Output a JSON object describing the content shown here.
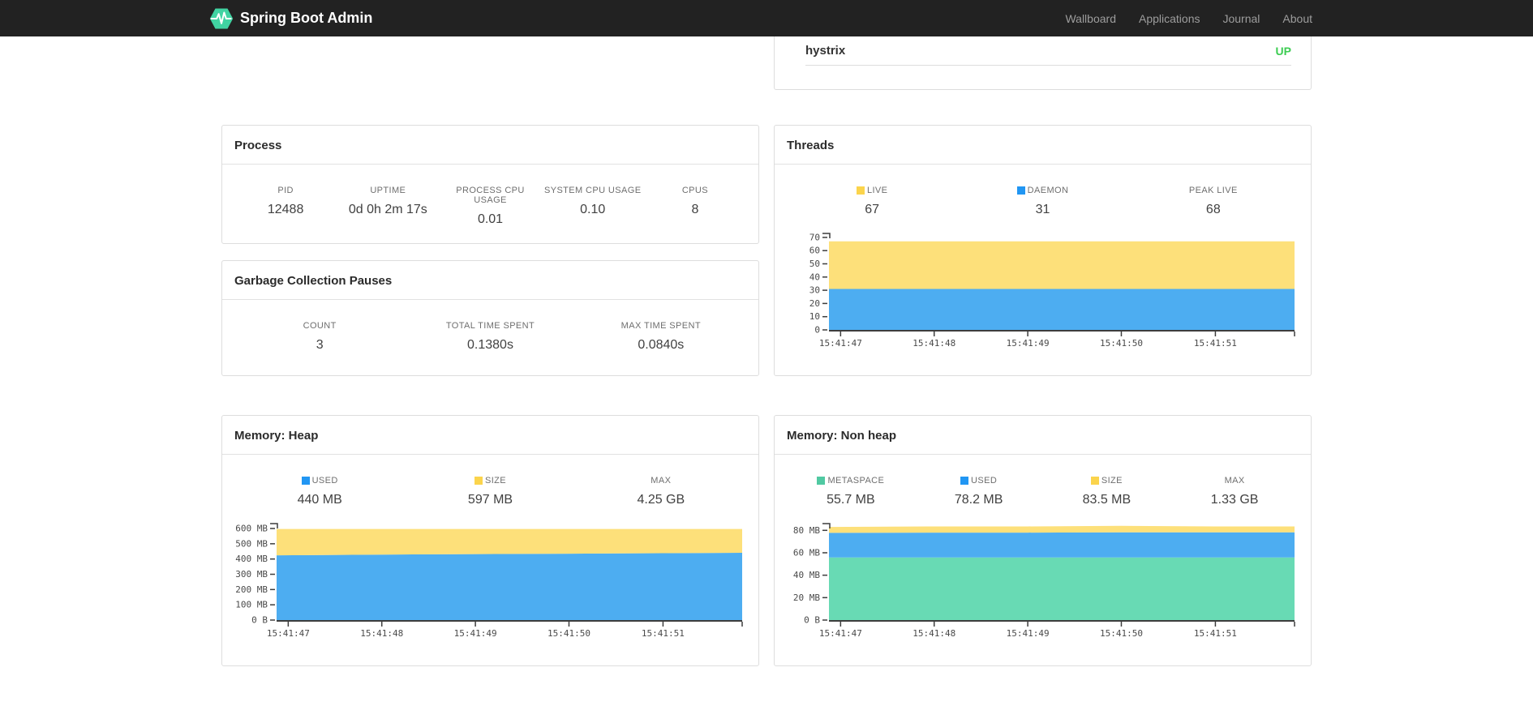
{
  "navbar": {
    "brand": "Spring Boot Admin",
    "items": [
      {
        "label": "Wallboard"
      },
      {
        "label": "Applications"
      },
      {
        "label": "Journal"
      },
      {
        "label": "About"
      }
    ]
  },
  "application_card": {
    "name": "hystrix",
    "status": "UP",
    "status_color": "#3ccc52"
  },
  "process": {
    "title": "Process",
    "metrics": [
      {
        "label": "PID",
        "value": "12488"
      },
      {
        "label": "UPTIME",
        "value": "0d 0h 2m 17s"
      },
      {
        "label": "PROCESS CPU USAGE",
        "value": "0.01"
      },
      {
        "label": "SYSTEM CPU USAGE",
        "value": "0.10"
      },
      {
        "label": "CPUS",
        "value": "8"
      }
    ]
  },
  "gc": {
    "title": "Garbage Collection Pauses",
    "metrics": [
      {
        "label": "COUNT",
        "value": "3"
      },
      {
        "label": "TOTAL TIME SPENT",
        "value": "0.1380s"
      },
      {
        "label": "MAX TIME SPENT",
        "value": "0.0840s"
      }
    ]
  },
  "threads": {
    "title": "Threads",
    "metrics": [
      {
        "label": "LIVE",
        "value": "67",
        "swatch": "#fbd44c"
      },
      {
        "label": "DAEMON",
        "value": "31",
        "swatch": "#2196f3"
      },
      {
        "label": "PEAK LIVE",
        "value": "68"
      }
    ]
  },
  "heap": {
    "title": "Memory: Heap",
    "metrics": [
      {
        "label": "USED",
        "value": "440 MB",
        "swatch": "#2196f3"
      },
      {
        "label": "SIZE",
        "value": "597 MB",
        "swatch": "#fbd44c"
      },
      {
        "label": "MAX",
        "value": "4.25 GB"
      }
    ]
  },
  "nonheap": {
    "title": "Memory: Non heap",
    "metrics": [
      {
        "label": "METASPACE",
        "value": "55.7 MB",
        "swatch": "#50c9a2"
      },
      {
        "label": "USED",
        "value": "78.2 MB",
        "swatch": "#2196f3"
      },
      {
        "label": "SIZE",
        "value": "83.5 MB",
        "swatch": "#fbd44c"
      },
      {
        "label": "MAX",
        "value": "1.33 GB"
      }
    ]
  },
  "chart_data": [
    {
      "name": "threads",
      "type": "area",
      "x_ticks": [
        "15:41:47",
        "15:41:48",
        "15:41:49",
        "15:41:50",
        "15:41:51"
      ],
      "tick_fracs": [
        0.025,
        0.226,
        0.427,
        0.628,
        0.83
      ],
      "x_fracs": [
        0,
        0.226,
        0.427,
        0.628,
        0.83,
        1
      ],
      "y_ticks": [
        {
          "value": 0,
          "label": "0"
        },
        {
          "value": 10,
          "label": "10"
        },
        {
          "value": 20,
          "label": "20"
        },
        {
          "value": 30,
          "label": "30"
        },
        {
          "value": 40,
          "label": "40"
        },
        {
          "value": 50,
          "label": "50"
        },
        {
          "value": 60,
          "label": "60"
        },
        {
          "value": 70,
          "label": "70"
        }
      ],
      "y_plot_max": 73,
      "legend_position": "top",
      "grid": false,
      "series": [
        {
          "name": "daemon",
          "color": "#4dadf1",
          "values": [
            31,
            31,
            31,
            31,
            31,
            31
          ]
        },
        {
          "name": "live",
          "color": "#fde07a",
          "values": [
            67,
            67,
            67,
            67,
            67,
            67
          ]
        }
      ]
    },
    {
      "name": "memory-heap",
      "type": "area",
      "x_ticks": [
        "15:41:47",
        "15:41:48",
        "15:41:49",
        "15:41:50",
        "15:41:51"
      ],
      "tick_fracs": [
        0.025,
        0.226,
        0.427,
        0.628,
        0.83
      ],
      "x_fracs": [
        0,
        0.226,
        0.427,
        0.628,
        0.83,
        1
      ],
      "y_ticks": [
        {
          "value": 0,
          "label": "0 B"
        },
        {
          "value": 100,
          "label": "100 MB"
        },
        {
          "value": 200,
          "label": "200 MB"
        },
        {
          "value": 300,
          "label": "300 MB"
        },
        {
          "value": 400,
          "label": "400 MB"
        },
        {
          "value": 500,
          "label": "500 MB"
        },
        {
          "value": 600,
          "label": "600 MB"
        }
      ],
      "y_plot_max": 632,
      "legend_position": "top",
      "grid": false,
      "series": [
        {
          "name": "used",
          "color": "#4dadf1",
          "values": [
            424,
            429,
            432,
            435,
            438,
            441
          ]
        },
        {
          "name": "size",
          "color": "#fde07a",
          "values": [
            597,
            597,
            597,
            597,
            597,
            597
          ]
        }
      ]
    },
    {
      "name": "memory-nonheap",
      "type": "area",
      "x_ticks": [
        "15:41:47",
        "15:41:48",
        "15:41:49",
        "15:41:50",
        "15:41:51"
      ],
      "tick_fracs": [
        0.025,
        0.226,
        0.427,
        0.628,
        0.83
      ],
      "x_fracs": [
        0,
        0.226,
        0.427,
        0.628,
        0.83,
        1
      ],
      "y_ticks": [
        {
          "value": 0,
          "label": "0 B"
        },
        {
          "value": 20,
          "label": "20 MB"
        },
        {
          "value": 40,
          "label": "40 MB"
        },
        {
          "value": 60,
          "label": "60 MB"
        },
        {
          "value": 80,
          "label": "80 MB"
        }
      ],
      "y_plot_max": 86,
      "legend_position": "top",
      "grid": false,
      "series": [
        {
          "name": "metaspace",
          "color": "#68dab4",
          "values": [
            55.8,
            55.8,
            55.8,
            55.8,
            55.8,
            55.8
          ]
        },
        {
          "name": "used",
          "color": "#4dadf1",
          "values": [
            77.8,
            78,
            78,
            78.2,
            78.2,
            78.2
          ]
        },
        {
          "name": "size",
          "color": "#fde07a",
          "values": [
            83,
            83.5,
            83.5,
            84,
            83.5,
            83.5
          ]
        }
      ]
    }
  ]
}
